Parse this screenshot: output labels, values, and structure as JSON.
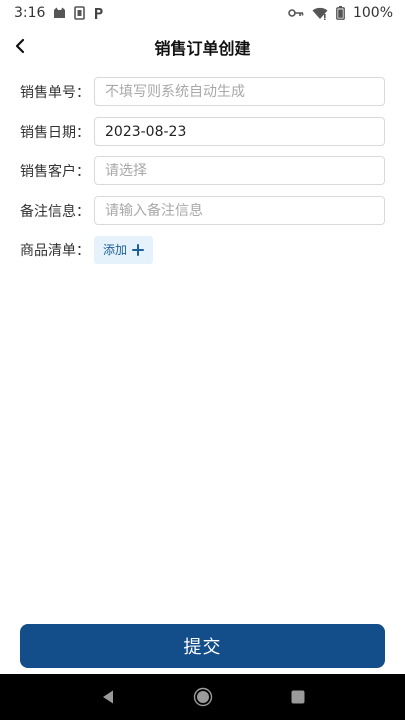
{
  "status_bar": {
    "time": "3:16",
    "battery": "100%",
    "icons": [
      "cat-icon",
      "sim-card-icon",
      "parking-p-icon",
      "key-icon",
      "wifi-icon",
      "battery-icon"
    ]
  },
  "header": {
    "title": "销售订单创建",
    "back_icon": "chevron-left-icon"
  },
  "form": {
    "order_no": {
      "label": "销售单号：",
      "value": "",
      "placeholder": "不填写则系统自动生成"
    },
    "order_date": {
      "label": "销售日期：",
      "value": "2023-08-23",
      "placeholder": ""
    },
    "customer": {
      "label": "销售客户：",
      "value": "",
      "placeholder": "请选择"
    },
    "remark": {
      "label": "备注信息：",
      "value": "",
      "placeholder": "请输入备注信息"
    },
    "goods": {
      "label": "商品清单：",
      "add_label": "添加"
    }
  },
  "submit": {
    "label": "提交"
  },
  "colors": {
    "primary": "#134d8a",
    "add_button_bg": "#e6f2fb",
    "add_button_text": "#1d5f98",
    "nav_bar": "#000000"
  },
  "nav_bar": {
    "icons": [
      "back-triangle-icon",
      "home-circle-icon",
      "recents-square-icon"
    ]
  }
}
